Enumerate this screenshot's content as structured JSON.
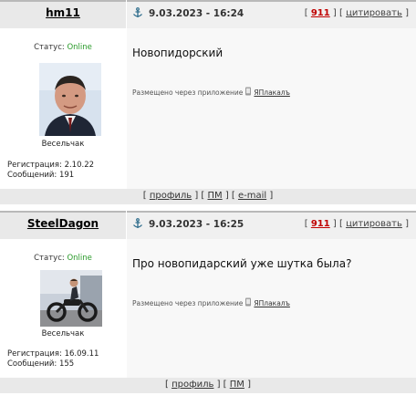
{
  "posts": [
    {
      "username": "hm11",
      "date": "9.03.2023 - 16:24",
      "post_number": "911",
      "quote_label": "цитировать",
      "status_label": "Статус:",
      "status_value": "Online",
      "rank": "Весельчак",
      "registration": "Регистрация: 2.10.22",
      "messages": "Сообщений: 191",
      "text": "Новопидорский",
      "via_prefix": "Размещено через приложение",
      "app_name": "ЯПлакалъ",
      "footer_links": [
        "профиль",
        "ПМ",
        "e-mail"
      ]
    },
    {
      "username": "SteelDagon",
      "date": "9.03.2023 - 16:25",
      "post_number": "911",
      "quote_label": "цитировать",
      "status_label": "Статус:",
      "status_value": "Online",
      "rank": "Весельчак",
      "registration": "Регистрация: 16.09.11",
      "messages": "Сообщений: 155",
      "text": "Про новопидарский уже шутка была?",
      "via_prefix": "Размещено через приложение",
      "app_name": "ЯПлакалъ",
      "footer_links": [
        "профиль",
        "ПМ"
      ]
    }
  ],
  "colors": {
    "online": "#2a9a2a",
    "post_number": "#c00000"
  },
  "icons": [
    "anchor-icon",
    "phone-icon"
  ]
}
